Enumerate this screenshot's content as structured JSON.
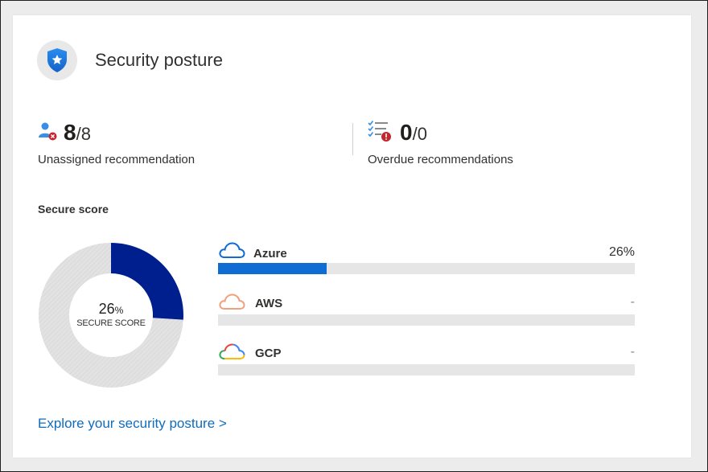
{
  "header": {
    "title": "Security posture",
    "icon": "shield-star-icon"
  },
  "metrics": [
    {
      "icon": "user-remove-icon",
      "value": "8",
      "total": "/8",
      "label": "Unassigned recommendation"
    },
    {
      "icon": "task-list-alert-icon",
      "value": "0",
      "total": "/0",
      "label": "Overdue recommendations"
    }
  ],
  "secure_score": {
    "section_title": "Secure score",
    "percent": 26,
    "center_value": "26",
    "center_unit": "%",
    "center_label": "SECURE SCORE",
    "colors": {
      "filled": "#001f8f",
      "remaining": "#e3e3e3"
    }
  },
  "clouds": [
    {
      "name": "Azure",
      "value": "26%",
      "fill_percent": 26,
      "icon": "azure-cloud-icon",
      "color": "#0f6cd3"
    },
    {
      "name": "AWS",
      "value": "-",
      "fill_percent": 0,
      "icon": "aws-cloud-icon",
      "color": "#f0a07d"
    },
    {
      "name": "GCP",
      "value": "-",
      "fill_percent": 0,
      "icon": "gcp-cloud-icon",
      "color": "#4a90e2"
    }
  ],
  "footer": {
    "link_text": "Explore your security posture >"
  }
}
